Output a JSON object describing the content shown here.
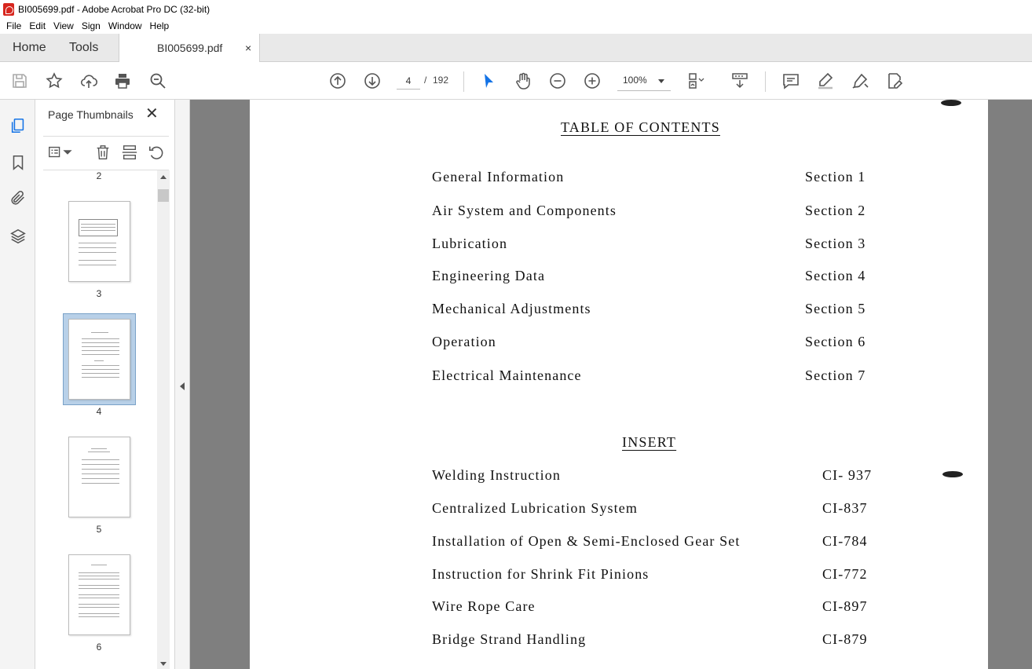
{
  "window": {
    "title": "BI005699.pdf - Adobe Acrobat Pro DC (32-bit)"
  },
  "menu": {
    "items": [
      "File",
      "Edit",
      "View",
      "Sign",
      "Window",
      "Help"
    ]
  },
  "tabs": {
    "home": "Home",
    "tools": "Tools",
    "document": "BI005699.pdf",
    "close": "×"
  },
  "toolbar": {
    "icons": [
      "save-icon",
      "star-icon",
      "upload-icon",
      "print-icon",
      "zoom-search-icon",
      "page-up-icon",
      "page-down-icon",
      "select-cursor-icon",
      "hand-icon",
      "zoom-out-icon",
      "zoom-in-icon",
      "fit-page-icon",
      "scroll-mode-icon",
      "comment-icon",
      "highlight-icon",
      "sign-icon",
      "edit-icon"
    ],
    "current_page": "4",
    "page_separator": "/",
    "total_pages": "192",
    "zoom": "100%"
  },
  "thumbnails": {
    "panel_title": "Page Thumbnails",
    "close": "✕",
    "pages": [
      "2",
      "3",
      "4",
      "5",
      "6"
    ],
    "selected_page": "4"
  },
  "document": {
    "toc_heading": "TABLE OF CONTENTS",
    "toc": [
      {
        "title": "General Information",
        "ref": "Section 1"
      },
      {
        "title": "Air System and Components",
        "ref": "Section 2"
      },
      {
        "title": "Lubrication",
        "ref": "Section 3"
      },
      {
        "title": "Engineering Data",
        "ref": "Section 4"
      },
      {
        "title": "Mechanical Adjustments",
        "ref": "Section 5"
      },
      {
        "title": "Operation",
        "ref": "Section 6"
      },
      {
        "title": "Electrical Maintenance",
        "ref": "Section 7"
      }
    ],
    "insert_heading": "INSERT",
    "inserts": [
      {
        "title": "Welding Instruction",
        "ref": "CI- 937"
      },
      {
        "title": "Centralized Lubrication System",
        "ref": "CI-837"
      },
      {
        "title": "Installation of Open & Semi-Enclosed Gear Set",
        "ref": "CI-784"
      },
      {
        "title": "Instruction for Shrink Fit Pinions",
        "ref": "CI-772"
      },
      {
        "title": "Wire Rope Care",
        "ref": "CI-897"
      },
      {
        "title": "Bridge Strand Handling",
        "ref": "CI-879"
      }
    ]
  },
  "colors": {
    "accent": "#1473e6",
    "viewport_bg": "#7f7f7f",
    "selection": "#b8d0e8"
  }
}
